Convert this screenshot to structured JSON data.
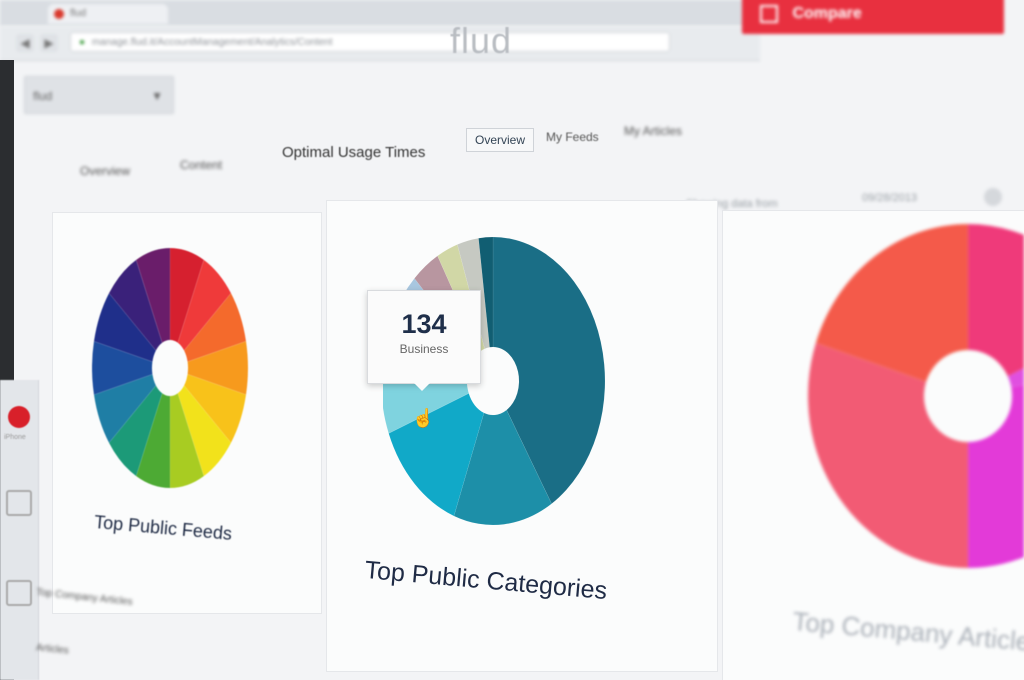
{
  "browser": {
    "tab_title": "flud",
    "url": "manage.flud.it/AccountManagement/Analytics/Content"
  },
  "header": {
    "logo": "flud",
    "compare_button": "Compare"
  },
  "selector": {
    "value": "flud",
    "chevron_icon": "chevron-down-icon"
  },
  "nav": {
    "items": [
      "Overview",
      "Content",
      "Optimal Usage Times"
    ],
    "subtabs": [
      "Overview",
      "My Feeds",
      "My Articles"
    ],
    "active_subtab": "Overview"
  },
  "filter": {
    "showing": "Showing data from",
    "date": "09/28/2013"
  },
  "sidebar": {
    "items": [
      {
        "icon": "apple-icon",
        "label": "iPhone"
      },
      {
        "icon": "people-icon",
        "label": ""
      },
      {
        "icon": "grid-icon",
        "label": ""
      }
    ]
  },
  "charts": [
    {
      "title": "Top Public Feeds"
    },
    {
      "title": "Top Public Categories"
    },
    {
      "title": "Top Company Articles"
    }
  ],
  "tooltip": {
    "value": "134",
    "label": "Business"
  },
  "bottom_rows": [
    "Top Company Articles",
    "Articles"
  ],
  "chart_data": [
    {
      "type": "pie",
      "title": "Top Public Feeds",
      "donut": true,
      "values": [
        1,
        1,
        1,
        1,
        1,
        1,
        1,
        1,
        1,
        1,
        1,
        1,
        1,
        1
      ],
      "colors": [
        "#d6202f",
        "#ef3a3a",
        "#f46a2c",
        "#f79a1d",
        "#f8c21a",
        "#f2e21b",
        "#a8cc22",
        "#4daa34",
        "#1c9a78",
        "#1f7ea5",
        "#1d4e9e",
        "#1f2f8a",
        "#3a217a",
        "#6a1d6a"
      ]
    },
    {
      "type": "pie",
      "title": "Top Public Categories",
      "donut": true,
      "values": [
        40,
        14,
        13,
        13,
        5,
        4,
        3,
        3,
        2
      ],
      "labels": [
        "",
        "",
        "",
        "Business",
        "",
        "",
        "",
        "",
        ""
      ],
      "colors": [
        "#1a6e86",
        "#1d8fa8",
        "#11a9c8",
        "#7fd3df",
        "#a8c7e0",
        "#b896a0",
        "#d1d7a6",
        "#c6c9c2",
        "#115e72"
      ]
    },
    {
      "type": "pie",
      "title": "Top Company Articles",
      "donut": true,
      "values": [
        18,
        4,
        28,
        30,
        20
      ],
      "colors": [
        "#ef3a7a",
        "#e04fe0",
        "#e33ad8",
        "#f25b74",
        "#f45a4a"
      ]
    }
  ]
}
